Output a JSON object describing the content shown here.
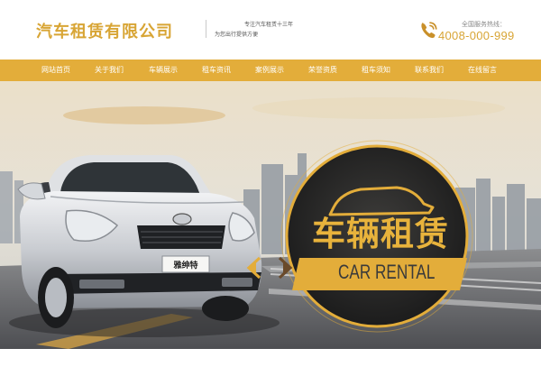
{
  "header": {
    "company_name": "汽车租赁有限公司",
    "slogan_line1": "专注汽车租赁十三年",
    "slogan_line2": "为您出行提供方便",
    "hotline_label": "全国服务热线：",
    "hotline_number": "4008-000-999"
  },
  "nav": {
    "items": [
      {
        "label": "网站首页"
      },
      {
        "label": "关于我们"
      },
      {
        "label": "车辆展示"
      },
      {
        "label": "租车资讯"
      },
      {
        "label": "案例展示"
      },
      {
        "label": "荣誉资质"
      },
      {
        "label": "租车须知"
      },
      {
        "label": "联系我们"
      },
      {
        "label": "在线留言"
      }
    ]
  },
  "banner": {
    "title_cn": "车辆租赁",
    "title_en": "CAR RENTAL",
    "car_badge_text": "雅绅特"
  },
  "colors": {
    "brand_gold": "#e3ad3a",
    "dark_text": "#3a3a3a"
  }
}
